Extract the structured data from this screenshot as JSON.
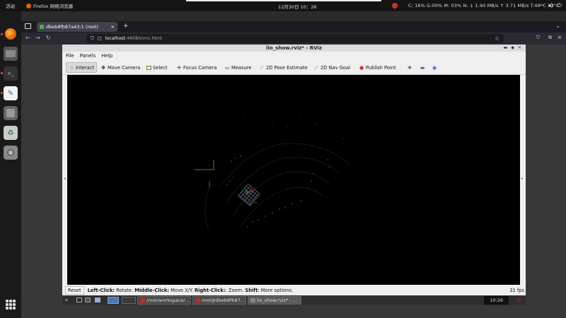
{
  "gnome": {
    "activities": "活动",
    "app_name": "Firefox 网络浏览器",
    "clock": "12月30日 10：26",
    "sysmon": "C: 16%  G:00%  M: 03%   N: ↓  1.90 MB/s ↑  3.71 MB/s  T:40°C 33°C"
  },
  "firefox": {
    "tab_title": "dbeb8fb87a43:1 (root)",
    "url_host": "localhost",
    "url_path": ":46080/vnc.html"
  },
  "rviz": {
    "window_title": "lio_show.rviz* - RViz",
    "menu": [
      "File",
      "Panels",
      "Help"
    ],
    "tools": {
      "interact": "Interact",
      "move_camera": "Move Camera",
      "select": "Select",
      "focus_camera": "Focus Camera",
      "measure": "Measure",
      "pose_estimate": "2D Pose Estimate",
      "nav_goal": "2D Nav Goal",
      "publish_point": "Publish Point"
    },
    "status": {
      "reset": "Reset",
      "left_click": "Left-Click:",
      "left_click_desc": " Rotate. ",
      "middle_click": "Middle-Click:",
      "middle_click_desc": " Move X/Y. ",
      "right_click": "Right-Click:",
      "right_click_desc": ": Zoom. ",
      "shift": "Shift",
      "shift_desc": ": More options.",
      "fps": "31 fps"
    }
  },
  "vnc_taskbar": {
    "items": [
      "/root/workspace/...",
      "root@dbeb8fb87...",
      "lio_show.rviz* - ..."
    ],
    "clock": "10:26"
  },
  "colors": {
    "accent": "#e95420",
    "viewport_bg": "#000000",
    "grid": "#9a9abf",
    "points_green": "#2e6b1e"
  }
}
